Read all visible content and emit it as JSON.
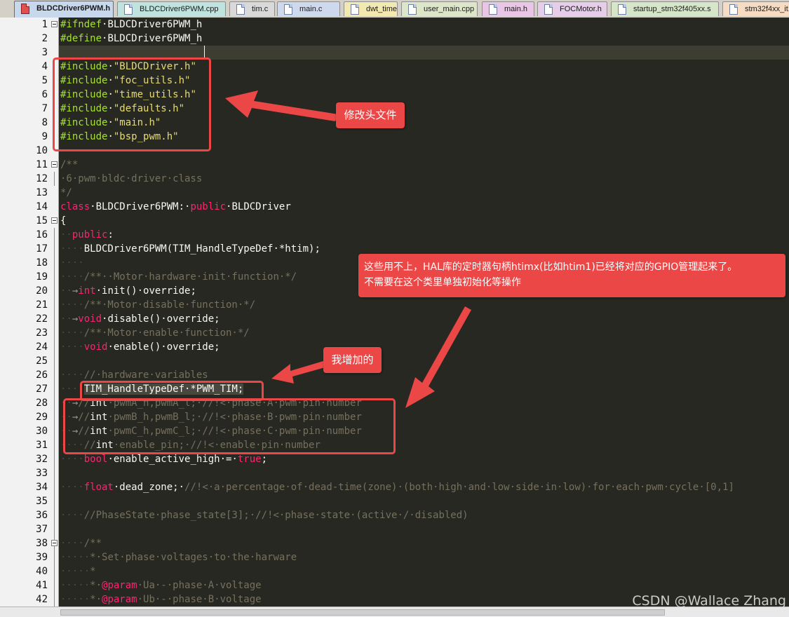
{
  "tabs": [
    {
      "label": "BLDCDriver6PWM.h",
      "active": true,
      "color": "#c7d8ed",
      "icon": "file-h-icon"
    },
    {
      "label": "BLDCDriver6PWM.cpp",
      "active": false,
      "color": "#bfe3df",
      "icon": "file-cpp-icon"
    },
    {
      "label": "tim.c",
      "active": false,
      "color": "#d9d9d9",
      "icon": "file-c-icon"
    },
    {
      "label": "main.c",
      "active": false,
      "color": "#cfd9ee",
      "icon": "file-c-icon"
    },
    {
      "label": "dwt_timer.c",
      "active": false,
      "color": "#f2e9b0",
      "icon": "file-c-icon"
    },
    {
      "label": "user_main.cpp",
      "active": false,
      "color": "#dde6c8",
      "icon": "file-cpp-icon"
    },
    {
      "label": "main.h",
      "active": false,
      "color": "#eac6e6",
      "icon": "file-h-icon"
    },
    {
      "label": "FOCMotor.h",
      "active": false,
      "color": "#e6cdea",
      "icon": "file-h-icon"
    },
    {
      "label": "startup_stm32f405xx.s",
      "active": false,
      "color": "#d6e7c9",
      "icon": "file-s-icon"
    },
    {
      "label": "stm32f4xx_it.c",
      "active": false,
      "color": "#f7dcc4",
      "icon": "file-c-icon"
    }
  ],
  "editor": {
    "current_line": 3,
    "lines": [
      {
        "n": "1",
        "fold": true,
        "parts": [
          [
            "pre",
            "#ifndef"
          ],
          [
            "",
            "·BLDCDriver6PWM_h"
          ]
        ]
      },
      {
        "n": "2",
        "parts": [
          [
            "pre",
            "#define"
          ],
          [
            "",
            "·BLDCDriver6PWM_h"
          ]
        ]
      },
      {
        "n": "3",
        "parts": []
      },
      {
        "n": "4",
        "parts": [
          [
            "pre",
            "#include"
          ],
          [
            "",
            "·"
          ],
          [
            "str",
            "\"BLDCDriver.h\""
          ]
        ]
      },
      {
        "n": "5",
        "parts": [
          [
            "pre",
            "#include"
          ],
          [
            "",
            "·"
          ],
          [
            "str",
            "\"foc_utils.h\""
          ]
        ]
      },
      {
        "n": "6",
        "parts": [
          [
            "pre",
            "#include"
          ],
          [
            "",
            "·"
          ],
          [
            "str",
            "\"time_utils.h\""
          ]
        ]
      },
      {
        "n": "7",
        "parts": [
          [
            "pre",
            "#include"
          ],
          [
            "",
            "·"
          ],
          [
            "str",
            "\"defaults.h\""
          ]
        ]
      },
      {
        "n": "8",
        "parts": [
          [
            "pre",
            "#include"
          ],
          [
            "",
            "·"
          ],
          [
            "str",
            "\"main.h\""
          ]
        ]
      },
      {
        "n": "9",
        "parts": [
          [
            "pre",
            "#include"
          ],
          [
            "",
            "·"
          ],
          [
            "str",
            "\"bsp_pwm.h\""
          ]
        ]
      },
      {
        "n": "10",
        "parts": []
      },
      {
        "n": "11",
        "fold": true,
        "parts": [
          [
            "com",
            "/**"
          ]
        ]
      },
      {
        "n": "12",
        "parts": [
          [
            "com",
            "·6·pwm·bldc·driver·class"
          ]
        ]
      },
      {
        "n": "13",
        "parts": [
          [
            "com",
            "*/"
          ]
        ]
      },
      {
        "n": "14",
        "parts": [
          [
            "kw",
            "class"
          ],
          [
            "",
            "·BLDCDriver6PWM:·"
          ],
          [
            "kw",
            "public"
          ],
          [
            "",
            "·BLDCDriver"
          ]
        ]
      },
      {
        "n": "15",
        "fold": true,
        "parts": [
          [
            "",
            "{"
          ]
        ]
      },
      {
        "n": "16",
        "parts": [
          [
            "ws",
            "··"
          ],
          [
            "kw",
            "public"
          ],
          [
            "",
            ":"
          ]
        ]
      },
      {
        "n": "17",
        "parts": [
          [
            "ws",
            "····"
          ],
          [
            "",
            "BLDCDriver6PWM(TIM_HandleTypeDef·*htim);"
          ]
        ]
      },
      {
        "n": "18",
        "parts": [
          [
            "ws",
            "····"
          ]
        ]
      },
      {
        "n": "19",
        "parts": [
          [
            "ws",
            "····"
          ],
          [
            "com",
            "/**··Motor·hardware·init·function·*/"
          ]
        ]
      },
      {
        "n": "20",
        "parts": [
          [
            "ws",
            "··"
          ],
          [
            "arrow",
            "→"
          ],
          [
            "kw",
            "int"
          ],
          [
            "",
            "·init()·override;"
          ]
        ]
      },
      {
        "n": "21",
        "parts": [
          [
            "ws",
            "····"
          ],
          [
            "com",
            "/**·Motor·disable·function·*/"
          ]
        ]
      },
      {
        "n": "22",
        "parts": [
          [
            "ws",
            "··"
          ],
          [
            "arrow",
            "→"
          ],
          [
            "kw",
            "void"
          ],
          [
            "",
            "·disable()·override;"
          ]
        ]
      },
      {
        "n": "23",
        "parts": [
          [
            "ws",
            "····"
          ],
          [
            "com",
            "/**·Motor·enable·function·*/"
          ]
        ]
      },
      {
        "n": "24",
        "parts": [
          [
            "ws",
            "····"
          ],
          [
            "kw",
            "void"
          ],
          [
            "",
            "·enable()·override;"
          ]
        ]
      },
      {
        "n": "25",
        "parts": []
      },
      {
        "n": "26",
        "parts": [
          [
            "ws",
            "····"
          ],
          [
            "com",
            "//·hardware·variables"
          ]
        ]
      },
      {
        "n": "27",
        "parts": [
          [
            "ws",
            "····"
          ],
          [
            "",
            "TIM_HandleTypeDef·*PWM_TIM;"
          ]
        ]
      },
      {
        "n": "28",
        "parts": [
          [
            "ws",
            "··"
          ],
          [
            "arrow",
            "→"
          ],
          [
            "com",
            "//"
          ],
          [
            "",
            "int"
          ],
          [
            "com",
            "·pwmA_h,pwmA_l;·//!<·phase·A·pwm·pin·number"
          ]
        ]
      },
      {
        "n": "29",
        "parts": [
          [
            "ws",
            "··"
          ],
          [
            "arrow",
            "→"
          ],
          [
            "com",
            "//"
          ],
          [
            "",
            "int"
          ],
          [
            "com",
            "·pwmB_h,pwmB_l;·//!<·phase·B·pwm·pin·number"
          ]
        ]
      },
      {
        "n": "30",
        "parts": [
          [
            "ws",
            "··"
          ],
          [
            "arrow",
            "→"
          ],
          [
            "com",
            "//"
          ],
          [
            "",
            "int"
          ],
          [
            "com",
            "·pwmC_h,pwmC_l;·//!<·phase·C·pwm·pin·number"
          ]
        ]
      },
      {
        "n": "31",
        "parts": [
          [
            "ws",
            "····"
          ],
          [
            "com",
            "//"
          ],
          [
            "",
            "int"
          ],
          [
            "com",
            "·enable_pin;·//!<·enable·pin·number"
          ]
        ]
      },
      {
        "n": "32",
        "parts": [
          [
            "ws",
            "····"
          ],
          [
            "kw",
            "bool"
          ],
          [
            "",
            "·enable_active_high·=·"
          ],
          [
            "kw",
            "true"
          ],
          [
            "",
            ";"
          ]
        ]
      },
      {
        "n": "33",
        "parts": []
      },
      {
        "n": "34",
        "parts": [
          [
            "ws",
            "····"
          ],
          [
            "kw",
            "float"
          ],
          [
            "",
            "·dead_zone;·"
          ],
          [
            "com",
            "//!<·a·percentage·of·dead-time(zone)·(both·high·and·low·side·in·low)·for·each·pwm·cycle·[0,1]"
          ]
        ]
      },
      {
        "n": "35",
        "parts": []
      },
      {
        "n": "36",
        "parts": [
          [
            "ws",
            "····"
          ],
          [
            "com",
            "//PhaseState·phase_state[3];·//!<·phase·state·(active·/·disabled)"
          ]
        ]
      },
      {
        "n": "37",
        "parts": []
      },
      {
        "n": "38",
        "fold": true,
        "parts": [
          [
            "ws",
            "····"
          ],
          [
            "com",
            "/**"
          ]
        ]
      },
      {
        "n": "39",
        "parts": [
          [
            "ws",
            "·····"
          ],
          [
            "com",
            "*·Set·phase·voltages·to·the·harware"
          ]
        ]
      },
      {
        "n": "40",
        "parts": [
          [
            "ws",
            "·····"
          ],
          [
            "com",
            "*"
          ]
        ]
      },
      {
        "n": "41",
        "parts": [
          [
            "ws",
            "·····"
          ],
          [
            "com",
            "*·"
          ],
          [
            "kw",
            "@param"
          ],
          [
            "com",
            "·Ua·-·phase·A·voltage"
          ]
        ]
      },
      {
        "n": "42",
        "parts": [
          [
            "ws",
            "·····"
          ],
          [
            "com",
            "*·"
          ],
          [
            "kw",
            "@param"
          ],
          [
            "com",
            "·Ub·-·phase·B·voltage"
          ]
        ]
      }
    ]
  },
  "annotations": {
    "callout_headers": "修改头文件",
    "callout_unused_1": "这些用不上，HAL库的定时器句柄htimx(比如htim1)已经将对应的GPIO管理起来了。",
    "callout_unused_2": "不需要在这个类里单独初始化等操作",
    "callout_added": "我增加的",
    "color": "#ec4747"
  },
  "watermark": "CSDN @Wallace Zhang",
  "colors": {
    "background": "#272822",
    "preprocessor": "#a6e22e",
    "string": "#e6db74",
    "keyword": "#f92672",
    "comment": "#75715e",
    "text": "#f8f8f2",
    "gutter": "#f2f2f2"
  }
}
